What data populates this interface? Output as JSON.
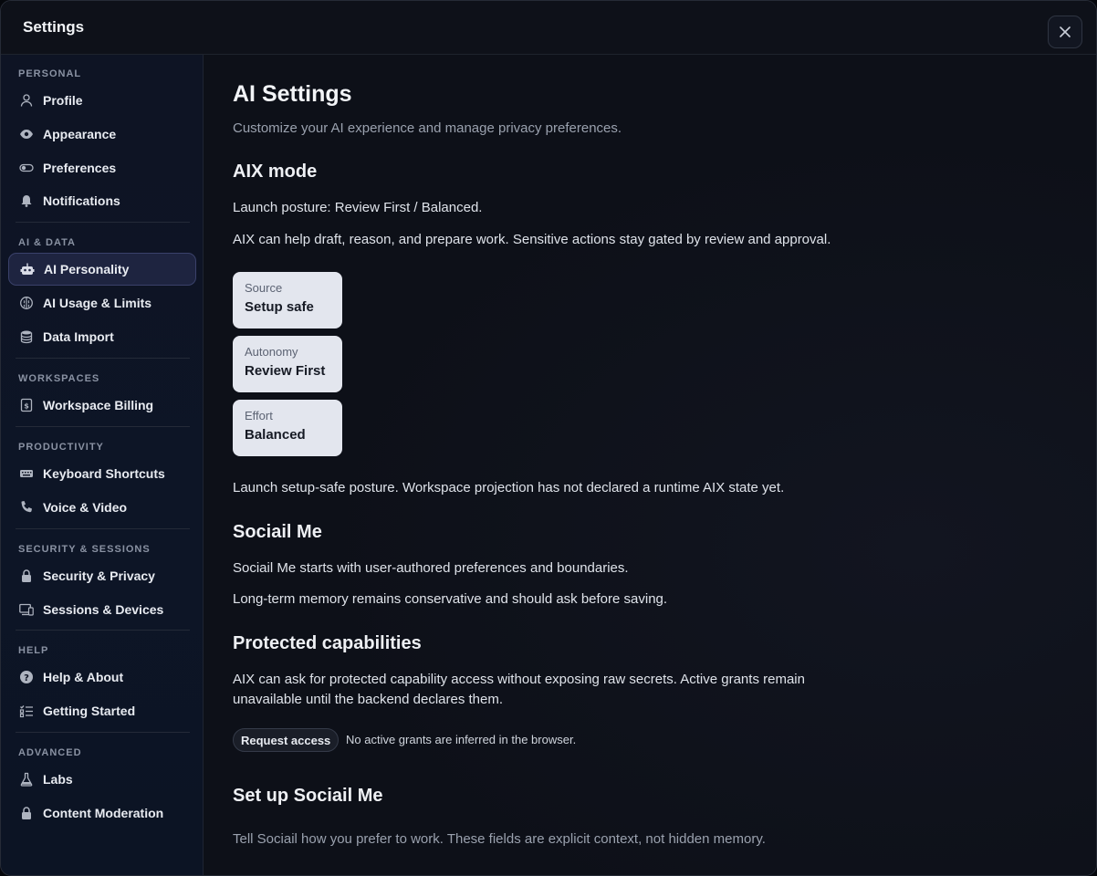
{
  "header": {
    "title": "Settings"
  },
  "sidebar": {
    "sections": [
      {
        "label": "PERSONAL",
        "items": [
          "Profile",
          "Appearance",
          "Preferences",
          "Notifications"
        ]
      },
      {
        "label": "AI & DATA",
        "items": [
          "AI Personality",
          "AI Usage & Limits",
          "Data Import"
        ]
      },
      {
        "label": "WORKSPACES",
        "items": [
          "Workspace Billing"
        ]
      },
      {
        "label": "PRODUCTIVITY",
        "items": [
          "Keyboard Shortcuts",
          "Voice & Video"
        ]
      },
      {
        "label": "SECURITY & SESSIONS",
        "items": [
          "Security & Privacy",
          "Sessions & Devices"
        ]
      },
      {
        "label": "HELP",
        "items": [
          "Help & About",
          "Getting Started"
        ]
      },
      {
        "label": "ADVANCED",
        "items": [
          "Labs",
          "Content Moderation"
        ]
      }
    ],
    "active_item": "AI Personality"
  },
  "main": {
    "title": "AI Settings",
    "subtitle": "Customize your AI experience and manage privacy preferences.",
    "aix": {
      "heading": "AIX mode",
      "posture": "Launch posture: Review First / Balanced.",
      "description": "AIX can help draft, reason, and prepare work. Sensitive actions stay gated by review and approval.",
      "cards": [
        {
          "label": "Source",
          "value": "Setup safe"
        },
        {
          "label": "Autonomy",
          "value": "Review First"
        },
        {
          "label": "Effort",
          "value": "Balanced"
        }
      ],
      "note": "Launch setup-safe posture. Workspace projection has not declared a runtime AIX state yet."
    },
    "sociail_me": {
      "heading": "Sociail Me",
      "line1": "Sociail Me starts with user-authored preferences and boundaries.",
      "line2": "Long-term memory remains conservative and should ask before saving."
    },
    "protected": {
      "heading": "Protected capabilities",
      "description": "AIX can ask for protected capability access without exposing raw secrets. Active grants remain unavailable until the backend declares them.",
      "button": "Request access",
      "note": "No active grants are inferred in the browser."
    },
    "setup": {
      "heading": "Set up Sociail Me",
      "description": "Tell Sociail how you prefer to work. These fields are explicit context, not hidden memory."
    }
  },
  "colors": {
    "accent_active_bg": "#1e2440",
    "card_bg": "#e3e6ee",
    "panel_bg": "#0d1018"
  }
}
